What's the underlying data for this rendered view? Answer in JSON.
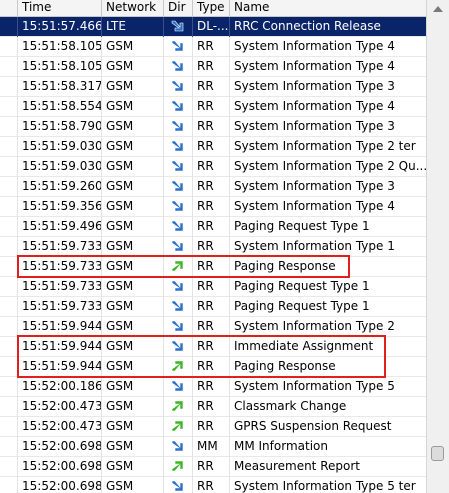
{
  "columns": {
    "time": "Time",
    "network": "Network",
    "dir": "Dir",
    "type": "Type",
    "name": "Name"
  },
  "rows": [
    {
      "time": "15:51:57.466",
      "network": "LTE",
      "dir": "down",
      "type": "DL-...",
      "name": "RRC Connection Release",
      "selected": true
    },
    {
      "time": "15:51:58.105",
      "network": "GSM",
      "dir": "down",
      "type": "RR",
      "name": "System Information Type 4"
    },
    {
      "time": "15:51:58.105",
      "network": "GSM",
      "dir": "down",
      "type": "RR",
      "name": "System Information Type 4"
    },
    {
      "time": "15:51:58.317",
      "network": "GSM",
      "dir": "down",
      "type": "RR",
      "name": "System Information Type 3"
    },
    {
      "time": "15:51:58.554",
      "network": "GSM",
      "dir": "down",
      "type": "RR",
      "name": "System Information Type 4"
    },
    {
      "time": "15:51:58.790",
      "network": "GSM",
      "dir": "down",
      "type": "RR",
      "name": "System Information Type 3"
    },
    {
      "time": "15:51:59.030",
      "network": "GSM",
      "dir": "down",
      "type": "RR",
      "name": "System Information Type 2 ter"
    },
    {
      "time": "15:51:59.030",
      "network": "GSM",
      "dir": "down",
      "type": "RR",
      "name": "System Information Type 2 Qu..."
    },
    {
      "time": "15:51:59.260",
      "network": "GSM",
      "dir": "down",
      "type": "RR",
      "name": "System Information Type 3"
    },
    {
      "time": "15:51:59.356",
      "network": "GSM",
      "dir": "down",
      "type": "RR",
      "name": "System Information Type 4"
    },
    {
      "time": "15:51:59.496",
      "network": "GSM",
      "dir": "down",
      "type": "RR",
      "name": "Paging Request Type 1"
    },
    {
      "time": "15:51:59.733",
      "network": "GSM",
      "dir": "down",
      "type": "RR",
      "name": "System Information Type 1"
    },
    {
      "time": "15:51:59.733",
      "network": "GSM",
      "dir": "up",
      "type": "RR",
      "name": "Paging Response"
    },
    {
      "time": "15:51:59.733",
      "network": "GSM",
      "dir": "down",
      "type": "RR",
      "name": "Paging Request Type 1"
    },
    {
      "time": "15:51:59.733",
      "network": "GSM",
      "dir": "down",
      "type": "RR",
      "name": "Paging Request Type 1"
    },
    {
      "time": "15:51:59.944",
      "network": "GSM",
      "dir": "down",
      "type": "RR",
      "name": "System Information Type 2"
    },
    {
      "time": "15:51:59.944",
      "network": "GSM",
      "dir": "down",
      "type": "RR",
      "name": "Immediate Assignment"
    },
    {
      "time": "15:51:59.944",
      "network": "GSM",
      "dir": "up",
      "type": "RR",
      "name": "Paging Response"
    },
    {
      "time": "15:52:00.186",
      "network": "GSM",
      "dir": "down",
      "type": "RR",
      "name": "System Information Type 5"
    },
    {
      "time": "15:52:00.473",
      "network": "GSM",
      "dir": "up",
      "type": "RR",
      "name": "Classmark Change"
    },
    {
      "time": "15:52:00.473",
      "network": "GSM",
      "dir": "up",
      "type": "RR",
      "name": "GPRS Suspension Request"
    },
    {
      "time": "15:52:00.698",
      "network": "GSM",
      "dir": "down",
      "type": "MM",
      "name": "MM Information"
    },
    {
      "time": "15:52:00.698",
      "network": "GSM",
      "dir": "up",
      "type": "RR",
      "name": "Measurement Report"
    },
    {
      "time": "15:52:00.698",
      "network": "GSM",
      "dir": "down",
      "type": "RR",
      "name": "System Information Type 5 ter"
    }
  ],
  "highlights": [
    [
      12,
      12
    ],
    [
      16,
      17
    ]
  ],
  "colors": {
    "selection": "#0a246a",
    "highlight_border": "#e0201e",
    "arrow_down": "#2a6fc9",
    "arrow_up": "#3bb526"
  }
}
